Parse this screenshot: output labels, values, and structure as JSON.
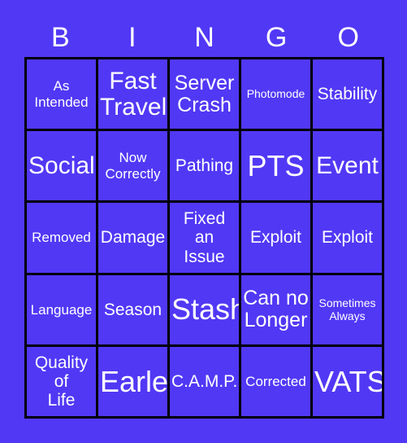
{
  "card": {
    "title": "BINGO",
    "background_color": "#5138f5",
    "cell_color": "#5138f5",
    "border_color": "#000000",
    "text_color": "#ffffff"
  },
  "header": {
    "letters": [
      {
        "label": "B"
      },
      {
        "label": "I"
      },
      {
        "label": "N"
      },
      {
        "label": "G"
      },
      {
        "label": "O"
      }
    ]
  },
  "grid": {
    "columns": 5,
    "rows": 5,
    "cells": [
      {
        "text": "As\nIntended",
        "size": "sm"
      },
      {
        "text": "Fast\nTravel",
        "size": "xl"
      },
      {
        "text": "Server\nCrash",
        "size": "lg"
      },
      {
        "text": "Photomode",
        "size": "xs"
      },
      {
        "text": "Stability",
        "size": "md"
      },
      {
        "text": "Social",
        "size": "xl"
      },
      {
        "text": "Now\nCorrectly",
        "size": "sm"
      },
      {
        "text": "Pathing",
        "size": "md"
      },
      {
        "text": "PTS",
        "size": "xxl"
      },
      {
        "text": "Event",
        "size": "xl"
      },
      {
        "text": "Removed",
        "size": "sm"
      },
      {
        "text": "Damage",
        "size": "md"
      },
      {
        "text": "Fixed\nan\nIssue",
        "size": "md"
      },
      {
        "text": "Exploit",
        "size": "md"
      },
      {
        "text": "Exploit",
        "size": "md"
      },
      {
        "text": "Language",
        "size": "sm"
      },
      {
        "text": "Season",
        "size": "md"
      },
      {
        "text": "Stash",
        "size": "xxl"
      },
      {
        "text": "Can no\nLonger",
        "size": "lg"
      },
      {
        "text": "Sometimes\nAlways",
        "size": "xs"
      },
      {
        "text": "Quality\nof\nLife",
        "size": "md"
      },
      {
        "text": "Earle",
        "size": "xxl"
      },
      {
        "text": "C.A.M.P.",
        "size": "md"
      },
      {
        "text": "Corrected",
        "size": "sm"
      },
      {
        "text": "VATS",
        "size": "xxl"
      }
    ]
  }
}
